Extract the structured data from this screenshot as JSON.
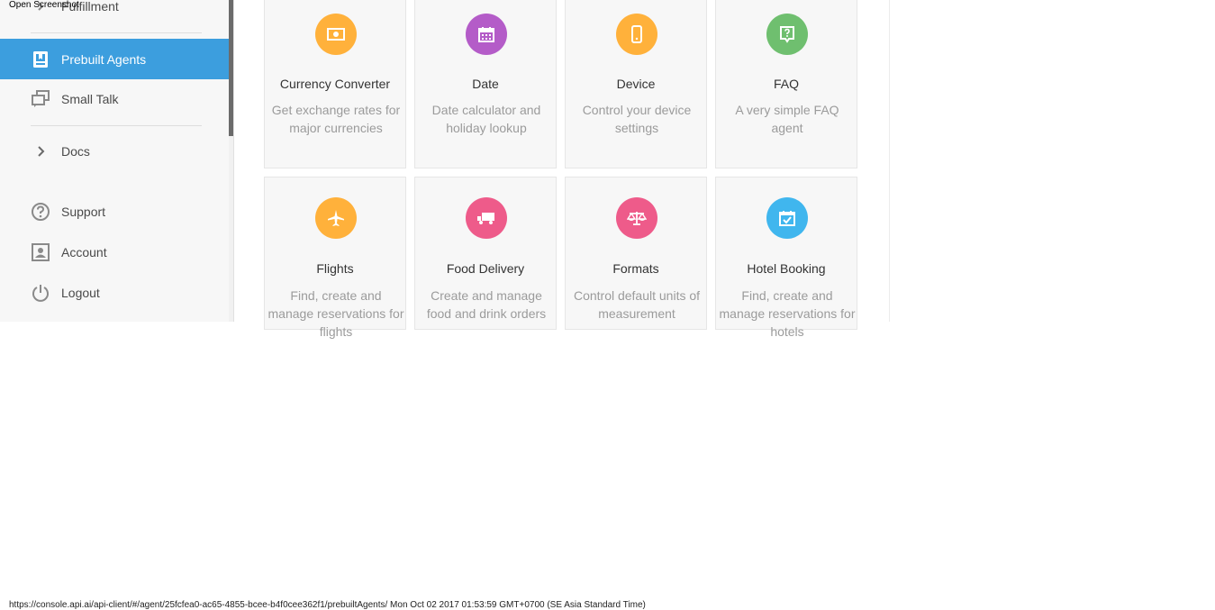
{
  "overlay_label": "Open Screenshot",
  "sidebar": {
    "items": [
      {
        "label": "Fulfillment",
        "icon": "chevron-right-icon"
      },
      {
        "label": "Prebuilt Agents",
        "icon": "book-icon",
        "active": true
      },
      {
        "label": "Small Talk",
        "icon": "chat-bubbles-icon"
      },
      {
        "label": "Docs",
        "icon": "chevron-right-icon"
      },
      {
        "label": "Support",
        "icon": "question-circle-icon"
      },
      {
        "label": "Account",
        "icon": "account-icon"
      },
      {
        "label": "Logout",
        "icon": "power-icon"
      }
    ]
  },
  "agents": [
    {
      "title": "Currency Converter",
      "description": "Get exchange rates for major currencies",
      "icon": "money-icon",
      "color": "#ffb13b"
    },
    {
      "title": "Date",
      "description": "Date calculator and holiday lookup",
      "icon": "calendar-icon",
      "color": "#b45cc8"
    },
    {
      "title": "Device",
      "description": "Control your device settings",
      "icon": "phone-icon",
      "color": "#ffb13b"
    },
    {
      "title": "FAQ",
      "description": "A very simple FAQ agent",
      "icon": "faq-icon",
      "color": "#6fbf6f"
    },
    {
      "title": "Flights",
      "description": "Find, create and manage reservations for flights",
      "icon": "airplane-icon",
      "color": "#ffb13b"
    },
    {
      "title": "Food Delivery",
      "description": "Create and manage food and drink orders",
      "icon": "truck-icon",
      "color": "#ee5b8a"
    },
    {
      "title": "Formats",
      "description": "Control default units of measurement",
      "icon": "scale-icon",
      "color": "#ee5b8a"
    },
    {
      "title": "Hotel Booking",
      "description": "Find, create and manage reservations for hotels",
      "icon": "calendar-check-icon",
      "color": "#40b6ee"
    }
  ],
  "colors": {
    "active_nav": "#3c9ede",
    "sidebar_bg": "#f7f7f7"
  },
  "status_bar": "https://console.api.ai/api-client/#/agent/25fcfea0-ac65-4855-bcee-b4f0cee362f1/prebuiltAgents/ Mon Oct 02 2017 01:53:59 GMT+0700 (SE Asia Standard Time)"
}
